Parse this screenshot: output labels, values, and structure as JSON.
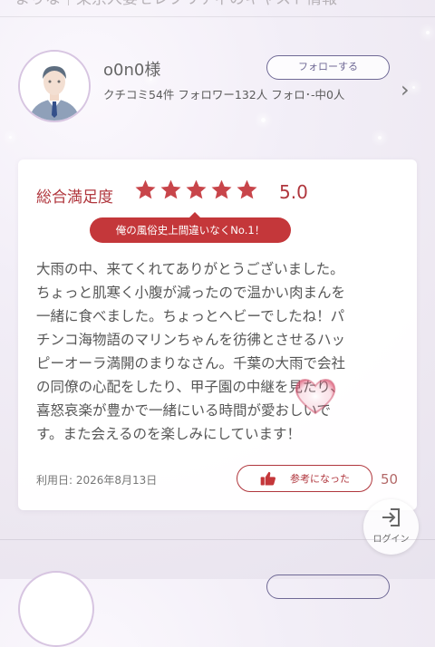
{
  "top_header": {
    "title": "まりな｜東京人妻セレブリティのキャスト情報"
  },
  "reviewer": {
    "name": "o0n0様",
    "follow_label": "フォローする",
    "stats": "クチコミ54件 フォロワー132人 フォロ･-中0人"
  },
  "review": {
    "satisfaction_label": "総合満足度",
    "stars": 5,
    "rating": "5.0",
    "headline": "俺の風俗史上間違いなくNo.1！",
    "body": "大雨の中、来てくれてありがとうございました。\nちょっと肌寒く小腹が減ったので温かい肉まんを\n一緒に食べました。ちょっとヘビーでしたね！パ\nチンコ海物語のマリンちゃんを彷彿とさせるハッ\nピーオーラ満開のまりなさん。千葉の大雨で会社\nの同僚の心配をしたり、甲子園の中継を見たり、\n喜怒哀楽が豊かで一緒にいる時間が愛おしいで\nす。また会えるのを楽しみにしています！",
    "usage_date": "利用日: 2026年8月13日",
    "helpful_label": "参考になった",
    "helpful_count": "50"
  },
  "login": {
    "label": "ログイン"
  },
  "colors": {
    "accent_red": "#c4373a",
    "star_red": "#c8454a",
    "follow_purple": "#6f6995"
  },
  "icons": {
    "avatar": "businessman-avatar-icon",
    "star": "star-icon",
    "thumb": "thumbs-up-icon",
    "chevron": "chevron-right-icon",
    "login": "login-icon"
  }
}
